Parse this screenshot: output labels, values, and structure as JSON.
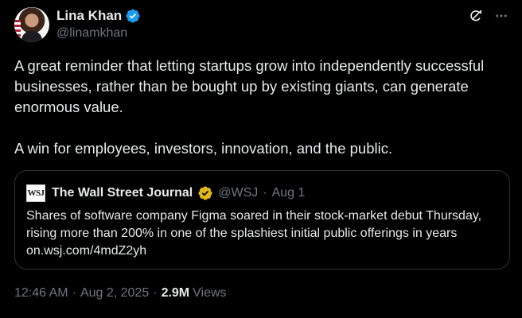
{
  "author": {
    "display_name": "Lina Khan",
    "handle": "@linamkhan",
    "verified": true,
    "verified_color": "#1d9bf0"
  },
  "post": {
    "paragraphs": [
      "A great reminder that letting startups grow into independently successful businesses, rather than be bought up by existing giants, can generate enormous value.",
      "A win for employees, investors, innovation, and the public."
    ]
  },
  "quoted": {
    "logo_text": "WSJ",
    "display_name": "The Wall Street Journal",
    "verified_color": "#e2b719",
    "handle": "@WSJ",
    "separator": "·",
    "date": "Aug 1",
    "text": "Shares of software company Figma soared in their stock-market debut Thursday, rising more than 200% in one of the splashiest initial public offerings in years",
    "link": "on.wsj.com/4mdZ2yh"
  },
  "footer": {
    "time": "12:46 AM",
    "separator": "·",
    "date": "Aug 2, 2025",
    "views_count": "2.9M",
    "views_label": "Views"
  },
  "icons": {
    "grok": "grok-icon",
    "more": "more-icon",
    "verified": "verified-badge-icon"
  }
}
